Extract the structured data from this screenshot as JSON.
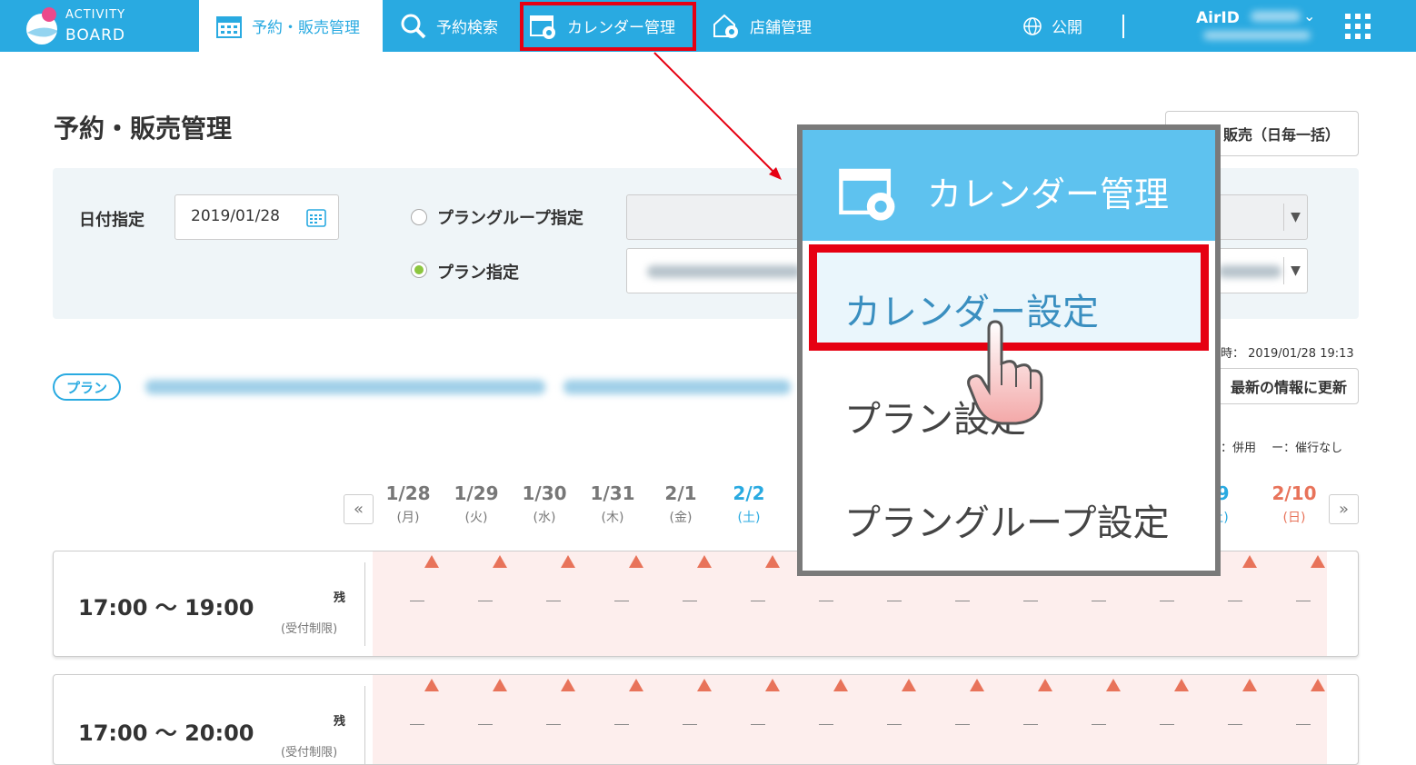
{
  "header": {
    "logo_line1": "ACTIVITY",
    "logo_line2": "BOARD",
    "nav": [
      {
        "label": "予約・販売管理",
        "icon": "calendar-icon"
      },
      {
        "label": "予約検索",
        "icon": "search-icon"
      },
      {
        "label": "カレンダー管理",
        "icon": "calendar-gear-icon"
      },
      {
        "label": "店舗管理",
        "icon": "store-gear-icon"
      }
    ],
    "public_label": "公開",
    "airid_label": "AirID"
  },
  "page": {
    "title": "予約・販売管理",
    "bulk_button": "販売（日毎一括）"
  },
  "filter": {
    "date_label": "日付指定",
    "date_value": "2019/01/28",
    "plan_group_label": "プラングループ指定",
    "plan_label": "プラン指定"
  },
  "plan": {
    "badge": "プラン",
    "updated_text": "時： 2019/01/28 19:13",
    "refresh_button": "最新の情報に更新",
    "legend_text": "：併用　 ー：催行なし"
  },
  "calendar": {
    "prev": "«",
    "next": "»",
    "days": [
      {
        "date": "1/28",
        "weekday": "(月)"
      },
      {
        "date": "1/29",
        "weekday": "(火)"
      },
      {
        "date": "1/30",
        "weekday": "(水)"
      },
      {
        "date": "1/31",
        "weekday": "(木)"
      },
      {
        "date": "2/1",
        "weekday": "(金)"
      },
      {
        "date": "2/2",
        "weekday": "(土)"
      },
      {
        "date": "/9",
        "weekday": "土)"
      },
      {
        "date": "2/10",
        "weekday": "(日)"
      }
    ]
  },
  "rows": [
    {
      "time": "17:00 ～ 19:00",
      "remain": "残",
      "restrict": "(受付制限)"
    },
    {
      "time": "17:00 ～ 20:00",
      "remain": "残",
      "restrict": "(受付制限)"
    }
  ],
  "popup": {
    "header": "カレンダー管理",
    "items": [
      "カレンダー設定",
      "プラン設定",
      "プラングループ設定"
    ]
  },
  "colors": {
    "brand": "#29aae1",
    "highlight": "#e60012",
    "saturday": "#29aae1",
    "sunday": "#e8735a"
  }
}
